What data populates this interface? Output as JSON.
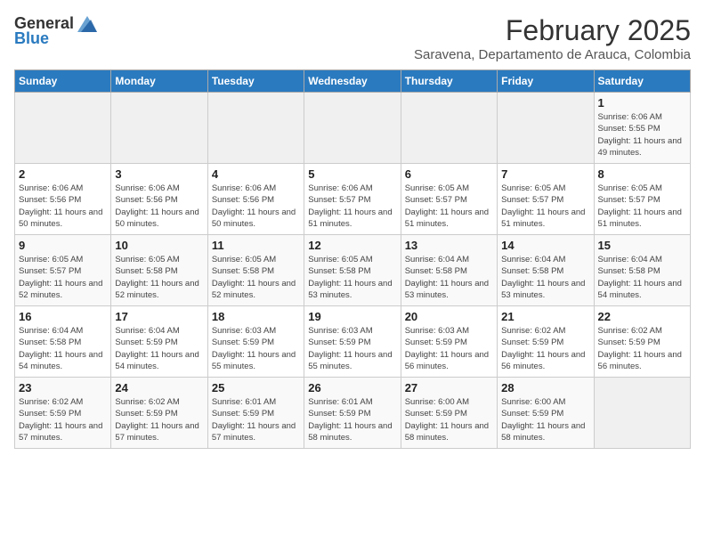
{
  "header": {
    "logo_general": "General",
    "logo_blue": "Blue",
    "title": "February 2025",
    "subtitle": "Saravena, Departamento de Arauca, Colombia"
  },
  "weekdays": [
    "Sunday",
    "Monday",
    "Tuesday",
    "Wednesday",
    "Thursday",
    "Friday",
    "Saturday"
  ],
  "weeks": [
    [
      {
        "day": "",
        "info": ""
      },
      {
        "day": "",
        "info": ""
      },
      {
        "day": "",
        "info": ""
      },
      {
        "day": "",
        "info": ""
      },
      {
        "day": "",
        "info": ""
      },
      {
        "day": "",
        "info": ""
      },
      {
        "day": "1",
        "info": "Sunrise: 6:06 AM\nSunset: 5:55 PM\nDaylight: 11 hours and 49 minutes."
      }
    ],
    [
      {
        "day": "2",
        "info": "Sunrise: 6:06 AM\nSunset: 5:56 PM\nDaylight: 11 hours and 50 minutes."
      },
      {
        "day": "3",
        "info": "Sunrise: 6:06 AM\nSunset: 5:56 PM\nDaylight: 11 hours and 50 minutes."
      },
      {
        "day": "4",
        "info": "Sunrise: 6:06 AM\nSunset: 5:56 PM\nDaylight: 11 hours and 50 minutes."
      },
      {
        "day": "5",
        "info": "Sunrise: 6:06 AM\nSunset: 5:57 PM\nDaylight: 11 hours and 51 minutes."
      },
      {
        "day": "6",
        "info": "Sunrise: 6:05 AM\nSunset: 5:57 PM\nDaylight: 11 hours and 51 minutes."
      },
      {
        "day": "7",
        "info": "Sunrise: 6:05 AM\nSunset: 5:57 PM\nDaylight: 11 hours and 51 minutes."
      },
      {
        "day": "8",
        "info": "Sunrise: 6:05 AM\nSunset: 5:57 PM\nDaylight: 11 hours and 51 minutes."
      }
    ],
    [
      {
        "day": "9",
        "info": "Sunrise: 6:05 AM\nSunset: 5:57 PM\nDaylight: 11 hours and 52 minutes."
      },
      {
        "day": "10",
        "info": "Sunrise: 6:05 AM\nSunset: 5:58 PM\nDaylight: 11 hours and 52 minutes."
      },
      {
        "day": "11",
        "info": "Sunrise: 6:05 AM\nSunset: 5:58 PM\nDaylight: 11 hours and 52 minutes."
      },
      {
        "day": "12",
        "info": "Sunrise: 6:05 AM\nSunset: 5:58 PM\nDaylight: 11 hours and 53 minutes."
      },
      {
        "day": "13",
        "info": "Sunrise: 6:04 AM\nSunset: 5:58 PM\nDaylight: 11 hours and 53 minutes."
      },
      {
        "day": "14",
        "info": "Sunrise: 6:04 AM\nSunset: 5:58 PM\nDaylight: 11 hours and 53 minutes."
      },
      {
        "day": "15",
        "info": "Sunrise: 6:04 AM\nSunset: 5:58 PM\nDaylight: 11 hours and 54 minutes."
      }
    ],
    [
      {
        "day": "16",
        "info": "Sunrise: 6:04 AM\nSunset: 5:58 PM\nDaylight: 11 hours and 54 minutes."
      },
      {
        "day": "17",
        "info": "Sunrise: 6:04 AM\nSunset: 5:59 PM\nDaylight: 11 hours and 54 minutes."
      },
      {
        "day": "18",
        "info": "Sunrise: 6:03 AM\nSunset: 5:59 PM\nDaylight: 11 hours and 55 minutes."
      },
      {
        "day": "19",
        "info": "Sunrise: 6:03 AM\nSunset: 5:59 PM\nDaylight: 11 hours and 55 minutes."
      },
      {
        "day": "20",
        "info": "Sunrise: 6:03 AM\nSunset: 5:59 PM\nDaylight: 11 hours and 56 minutes."
      },
      {
        "day": "21",
        "info": "Sunrise: 6:02 AM\nSunset: 5:59 PM\nDaylight: 11 hours and 56 minutes."
      },
      {
        "day": "22",
        "info": "Sunrise: 6:02 AM\nSunset: 5:59 PM\nDaylight: 11 hours and 56 minutes."
      }
    ],
    [
      {
        "day": "23",
        "info": "Sunrise: 6:02 AM\nSunset: 5:59 PM\nDaylight: 11 hours and 57 minutes."
      },
      {
        "day": "24",
        "info": "Sunrise: 6:02 AM\nSunset: 5:59 PM\nDaylight: 11 hours and 57 minutes."
      },
      {
        "day": "25",
        "info": "Sunrise: 6:01 AM\nSunset: 5:59 PM\nDaylight: 11 hours and 57 minutes."
      },
      {
        "day": "26",
        "info": "Sunrise: 6:01 AM\nSunset: 5:59 PM\nDaylight: 11 hours and 58 minutes."
      },
      {
        "day": "27",
        "info": "Sunrise: 6:00 AM\nSunset: 5:59 PM\nDaylight: 11 hours and 58 minutes."
      },
      {
        "day": "28",
        "info": "Sunrise: 6:00 AM\nSunset: 5:59 PM\nDaylight: 11 hours and 58 minutes."
      },
      {
        "day": "",
        "info": ""
      }
    ]
  ]
}
